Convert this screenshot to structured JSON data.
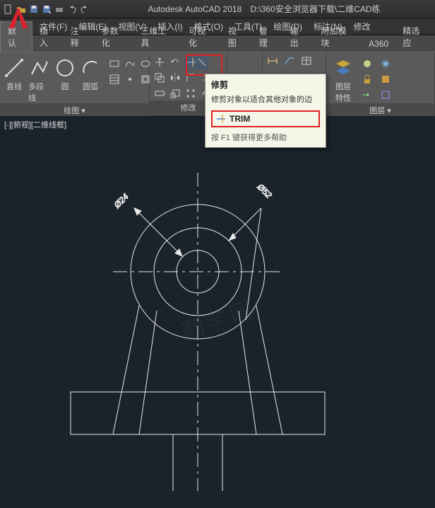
{
  "app": {
    "title": "Autodesk AutoCAD 2018",
    "filepath": "D:\\360安全浏览器下载\\二维CAD练"
  },
  "menus": [
    "文件(F)",
    "编辑(E)",
    "视图(V)",
    "插入(I)",
    "格式(O)",
    "工具(T)",
    "绘图(D)",
    "标注(N)",
    "修改"
  ],
  "tabs": [
    "默认",
    "插入",
    "注释",
    "参数化",
    "三维工具",
    "可视化",
    "视图",
    "管理",
    "输出",
    "附加模块",
    "A360",
    "精选应"
  ],
  "active_tab": 0,
  "panels": {
    "draw": {
      "title": "绘图 ▾",
      "buttons": {
        "line": "直线",
        "polyline": "多段线",
        "circle": "圆",
        "arc": "圆弧"
      }
    },
    "modify": {
      "title": "修改"
    },
    "layers": {
      "title": "图层 ▾",
      "props": "图层\n特性"
    },
    "text_tool": "A"
  },
  "tooltip": {
    "title": "修剪",
    "desc": "修剪对象以适合其他对象的边",
    "cmd": "TRIM",
    "help": "按 F1 键获得更多帮助"
  },
  "viewport_label": "[-][俯视][二维线框]",
  "dimensions": {
    "d1": "Ø24",
    "d2": "Ø52"
  }
}
